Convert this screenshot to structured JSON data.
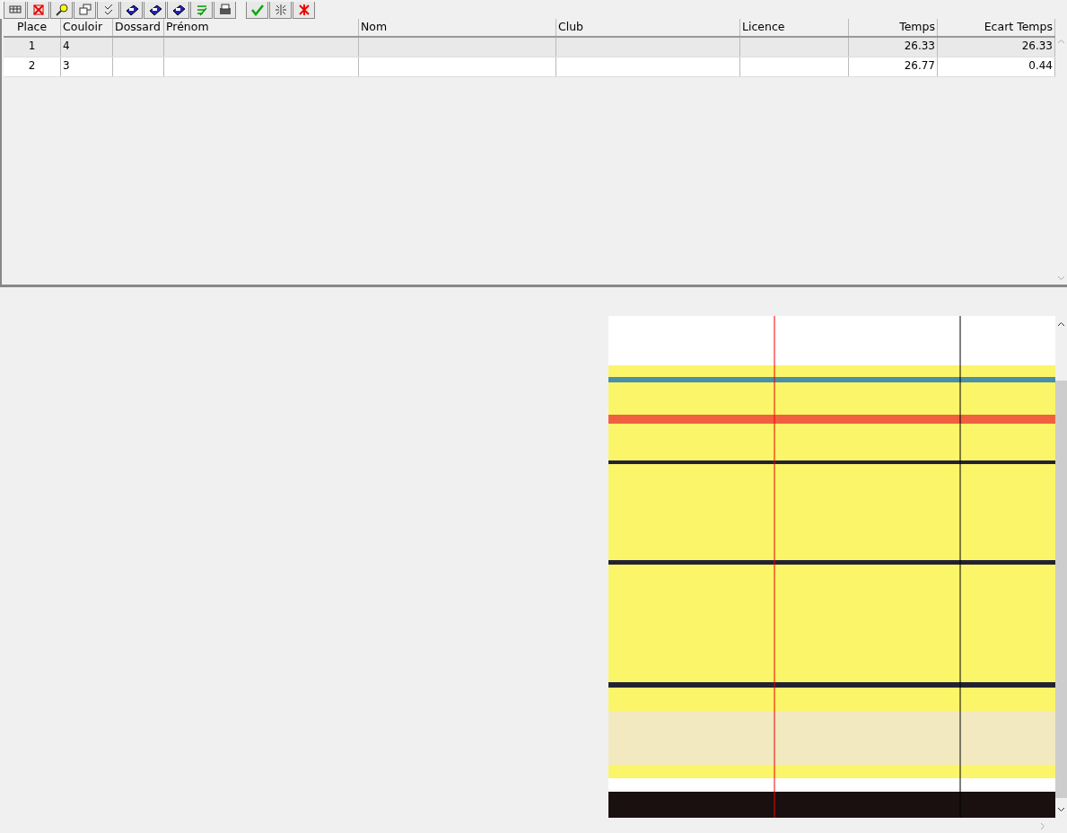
{
  "toolbar": {
    "buttons": [
      {
        "kind": "grid"
      },
      {
        "kind": "delete"
      },
      {
        "kind": "zoom"
      },
      {
        "kind": "windows"
      },
      {
        "kind": "checklist"
      },
      {
        "kind": "disk"
      },
      {
        "kind": "disk"
      },
      {
        "kind": "disk"
      },
      {
        "kind": "sort"
      },
      {
        "kind": "print"
      },
      {
        "kind": "check"
      },
      {
        "kind": "burst"
      },
      {
        "kind": "cross"
      }
    ]
  },
  "table": {
    "columns": [
      "Place",
      "Couloir",
      "Dossard",
      "Prénom",
      "Nom",
      "Club",
      "Licence",
      "Temps",
      "Ecart Temps"
    ],
    "rows": [
      {
        "selected": true,
        "cells": [
          "1",
          "4",
          "",
          "",
          "",
          "",
          "",
          "26.33",
          "26.33"
        ]
      },
      {
        "selected": false,
        "cells": [
          "2",
          "3",
          "",
          "",
          "",
          "",
          "",
          "26.77",
          "0.44"
        ]
      }
    ]
  }
}
